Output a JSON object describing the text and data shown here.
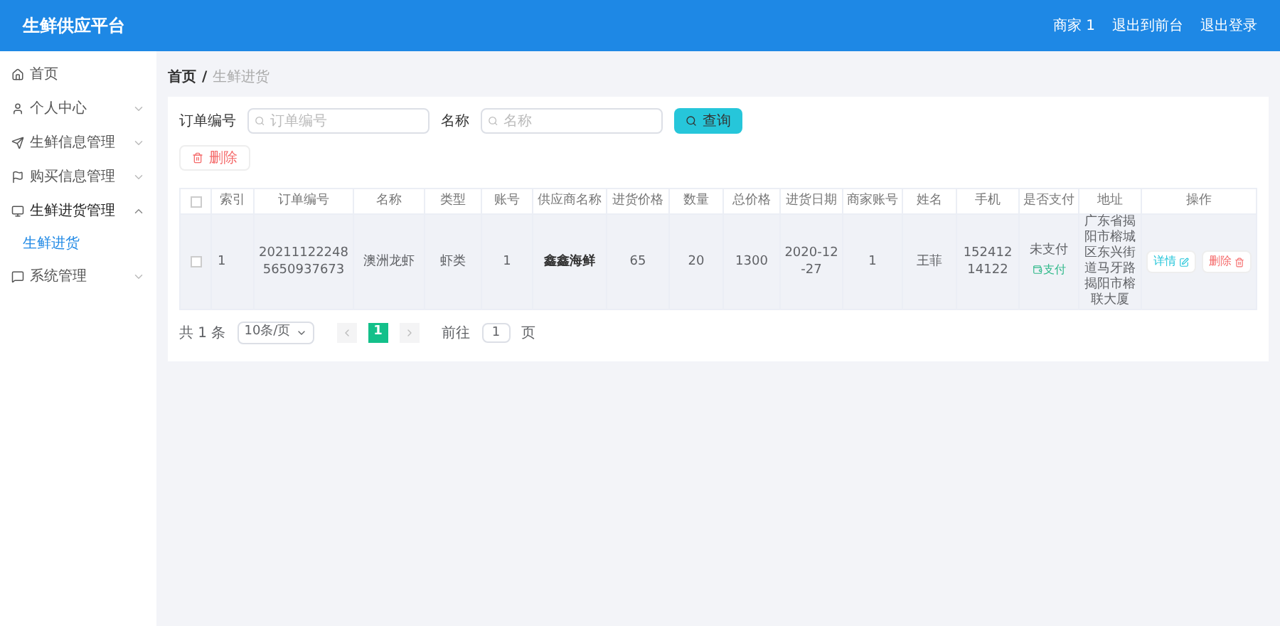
{
  "header": {
    "title": "生鲜供应平台",
    "links": [
      "商家 1",
      "退出到前台",
      "退出登录"
    ]
  },
  "sidebar": {
    "items": [
      {
        "label": "首页",
        "kind": "link"
      },
      {
        "label": "个人中心",
        "kind": "group",
        "expanded": false
      },
      {
        "label": "生鲜信息管理",
        "kind": "group",
        "expanded": false
      },
      {
        "label": "购买信息管理",
        "kind": "group",
        "expanded": false
      },
      {
        "label": "生鲜进货管理",
        "kind": "group",
        "expanded": true,
        "children": [
          {
            "label": "生鲜进货",
            "selected": true
          }
        ]
      },
      {
        "label": "系统管理",
        "kind": "group",
        "expanded": false
      }
    ]
  },
  "breadcrumb": [
    "首页",
    "/",
    "生鲜进货"
  ],
  "search": {
    "fields": [
      {
        "label": "订单编号",
        "placeholder": "订单编号"
      },
      {
        "label": "名称",
        "placeholder": "名称"
      }
    ],
    "button": "查询"
  },
  "delete_button": "删除",
  "table": {
    "all_checked": false,
    "columns": [
      "索引",
      "订单编号",
      "名称",
      "类型",
      "账号",
      "供应商名称",
      "进货价格",
      "数量",
      "总价格",
      "进货日期",
      "商家账号",
      "姓名",
      "手机",
      "是否支付",
      "地址",
      "操作"
    ],
    "rows": [
      {
        "checked": false,
        "cells": [
          "1",
          "202111222485650937673",
          "澳洲龙虾",
          "虾类",
          "1",
          "鑫鑫海鲜",
          "65",
          "20",
          "1300",
          "2020-12-27",
          "1",
          "王菲",
          "15241214122"
        ],
        "pay_status": "未支付",
        "pay_link": "支付",
        "address": "广东省揭阳市榕城区东兴街道马牙路揭阳市榕联大厦",
        "actions": [
          "详情",
          "删除"
        ]
      }
    ]
  },
  "pagination": {
    "total": "共 1 条",
    "page_size": "10条/页",
    "pages": [
      {
        "label": "1",
        "selected": true
      }
    ],
    "goto_label": "前往",
    "goto_value": "1",
    "goto_suffix": "页"
  }
}
